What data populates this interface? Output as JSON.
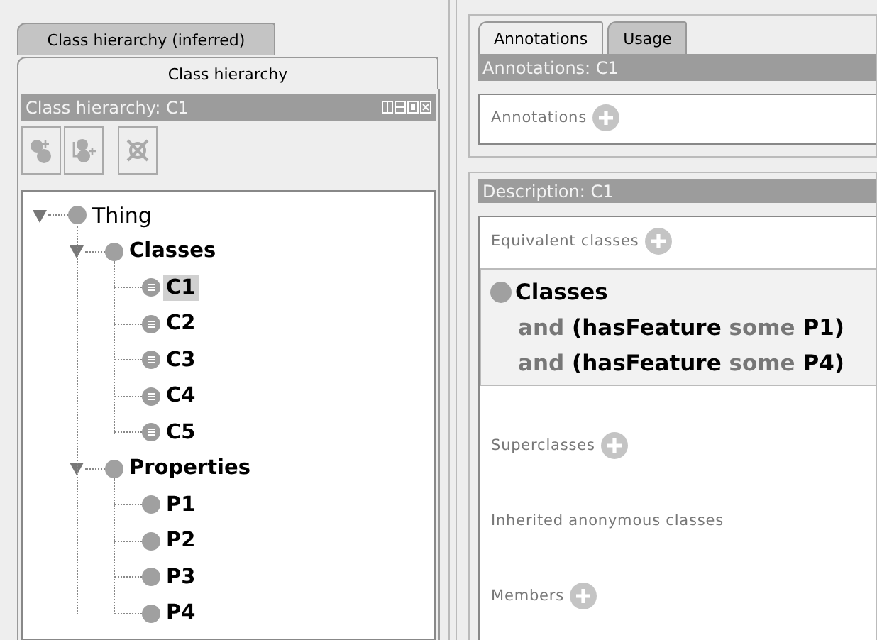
{
  "hierarchy_view": {
    "tabs": [
      {
        "label": "Class hierarchy (inferred)",
        "selected": false
      },
      {
        "label": "Class hierarchy",
        "selected": true
      }
    ],
    "title": "Class hierarchy: C1",
    "tree": [
      {
        "label": "Thing",
        "kind": "thing",
        "expanded": true,
        "selected": false,
        "children": [
          {
            "label": "Classes",
            "kind": "class",
            "expanded": true,
            "selected": false,
            "children": [
              {
                "label": "C1",
                "kind": "defined",
                "selected": true
              },
              {
                "label": "C2",
                "kind": "defined",
                "selected": false
              },
              {
                "label": "C3",
                "kind": "defined",
                "selected": false
              },
              {
                "label": "C4",
                "kind": "defined",
                "selected": false
              },
              {
                "label": "C5",
                "kind": "defined",
                "selected": false
              }
            ]
          },
          {
            "label": "Properties",
            "kind": "class",
            "expanded": true,
            "selected": false,
            "children": [
              {
                "label": "P1",
                "kind": "class",
                "selected": false
              },
              {
                "label": "P2",
                "kind": "class",
                "selected": false
              },
              {
                "label": "P3",
                "kind": "class",
                "selected": false
              },
              {
                "label": "P4",
                "kind": "class",
                "selected": false
              }
            ]
          }
        ]
      }
    ]
  },
  "annotations_view": {
    "tabs": [
      {
        "label": "Annotations",
        "selected": true
      },
      {
        "label": "Usage",
        "selected": false
      }
    ],
    "title": "Annotations: C1",
    "sections": [
      {
        "label": "Annotations",
        "addable": true
      }
    ]
  },
  "description_view": {
    "title": "Description: C1",
    "sections": [
      {
        "label": "Equivalent classes",
        "addable": true,
        "expressions": [
          {
            "lines": [
              [
                {
                  "text": "Classes",
                  "kind": "entity"
                }
              ],
              [
                {
                  "text": "and",
                  "kind": "keyword"
                },
                {
                  "text": "(hasFeature",
                  "kind": "entity"
                },
                {
                  "text": "some",
                  "kind": "keyword"
                },
                {
                  "text": "P1)",
                  "kind": "entity"
                }
              ],
              [
                {
                  "text": "and",
                  "kind": "keyword"
                },
                {
                  "text": "(hasFeature",
                  "kind": "entity"
                },
                {
                  "text": "some",
                  "kind": "keyword"
                },
                {
                  "text": "P4)",
                  "kind": "entity"
                }
              ]
            ]
          }
        ]
      },
      {
        "label": "Superclasses",
        "addable": true
      },
      {
        "label": "Inherited anonymous classes",
        "addable": false
      },
      {
        "label": "Members",
        "addable": true
      }
    ]
  }
}
